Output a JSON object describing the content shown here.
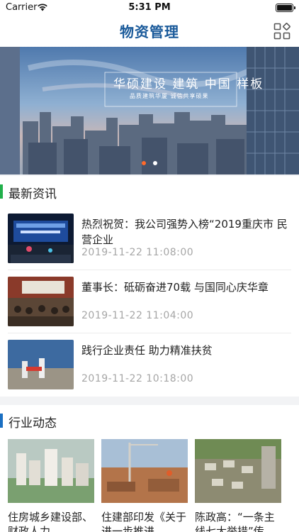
{
  "status_bar": {
    "carrier": "Carrier",
    "time": "5:31 PM"
  },
  "nav": {
    "title": "物资管理",
    "menu_icon": "grid-apps-icon"
  },
  "banner": {
    "brand": "华硕建设 建筑 中国 样板",
    "slogan": "品质建筑华厦 诚信共享硕果",
    "dots": [
      "active",
      "inactive"
    ],
    "accent_dot_color": "#ff6a2b"
  },
  "news_section": {
    "title": "最新资讯",
    "accent_color": "#22b04b",
    "items": [
      {
        "title": "热烈祝贺：我公司强势入榜“2019重庆市 民营企业",
        "time": "2019-11-22 11:08:00"
      },
      {
        "title": "董事长：砥砺奋进70载 与国同心庆华章",
        "time": "2019-11-22 11:04:00"
      },
      {
        "title": "践行企业责任 助力精准扶贫",
        "time": "2019-11-22 10:18:00"
      }
    ]
  },
  "industry_section": {
    "title": "行业动态",
    "accent_color": "#1a6fc2",
    "items": [
      {
        "title": "住房城乡建设部、财政人力"
      },
      {
        "title": "住建部印发《关于进一步推进"
      },
      {
        "title": "陈政高：“一条主线七大举措”传"
      }
    ]
  }
}
